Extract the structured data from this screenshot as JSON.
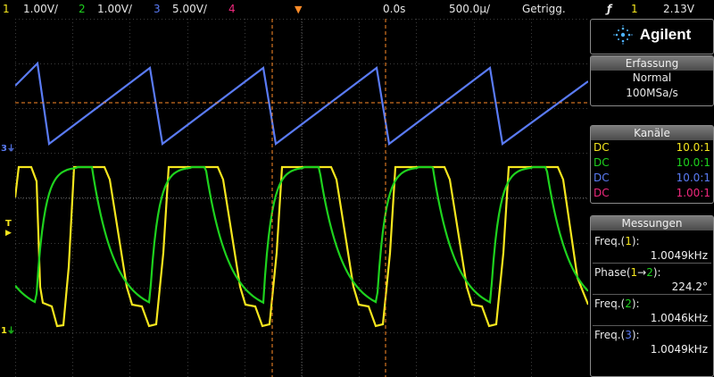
{
  "topbar": {
    "ch1_num": "1",
    "ch1_scale": "1.00V/",
    "ch2_num": "2",
    "ch2_scale": "1.00V/",
    "ch3_num": "3",
    "ch3_scale": "5.00V/",
    "ch4_num": "4",
    "time_offset": "0.0s",
    "time_scale": "500.0µ/",
    "trigger_status": "Getrigg.",
    "trigger_edge": "ƒ",
    "trigger_source": "1",
    "trigger_level": "2.13V"
  },
  "colors": {
    "ch1": "#f5e61e",
    "ch2": "#1ed21e",
    "ch3": "#5a7bf5",
    "ch4": "#f0287d",
    "cursor": "#ff8c28",
    "grid": "#3c3c3c"
  },
  "markers": {
    "ch3": "3",
    "trigger": "T",
    "ch1": "1"
  },
  "panel": {
    "brand": "Agilent",
    "brand_icon": "agilent-spark-icon",
    "acquisition": {
      "header": "Erfassung",
      "mode": "Normal",
      "rate": "100MSa/s"
    },
    "channels": {
      "header": "Kanäle",
      "rows": [
        {
          "coupling": "DC",
          "probe": "10.0:1"
        },
        {
          "coupling": "DC",
          "probe": "10.0:1"
        },
        {
          "coupling": "DC",
          "probe": "10.0:1"
        },
        {
          "coupling": "DC",
          "probe": "1.00:1"
        }
      ]
    },
    "measurements": {
      "header": "Messungen",
      "items": [
        {
          "name": "Freq.",
          "source": "1",
          "value": "1.0049kHz"
        },
        {
          "name": "Phase",
          "source_a": "1",
          "arrow": "→",
          "source_b": "2",
          "value": "224.2°"
        },
        {
          "name": "Freq.",
          "source": "2",
          "value": "1.0046kHz"
        },
        {
          "name": "Freq.",
          "source": "3",
          "value": "1.0049kHz"
        }
      ]
    }
  }
}
